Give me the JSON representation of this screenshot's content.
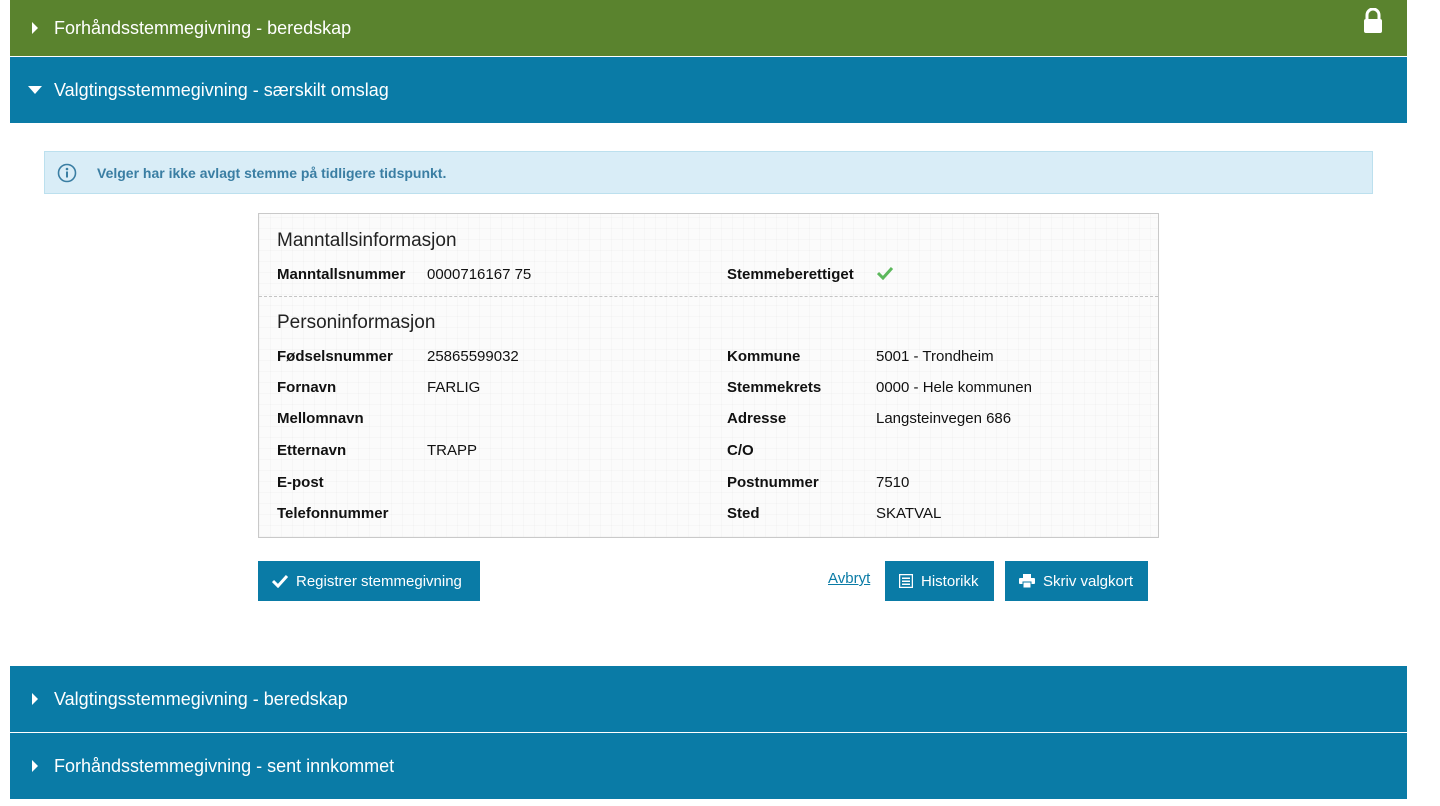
{
  "panels": {
    "p1": {
      "title": "Forhåndsstemmegivning - beredskap",
      "color": "#5a832e"
    },
    "p2": {
      "title": "Valgtingsstemmegivning - særskilt omslag",
      "color": "#0a7ba6"
    },
    "p3": {
      "title": "Valgtingsstemmegivning - beredskap",
      "color": "#0a7ba6"
    },
    "p4": {
      "title": "Forhåndsstemmegivning - sent innkommet",
      "color": "#0a7ba6"
    }
  },
  "info": {
    "message": "Velger har ikke avlagt stemme på tidligere tidspunkt."
  },
  "manntall": {
    "title": "Manntallsinformasjon",
    "number_label": "Manntallsnummer",
    "number_value": "0000716167 75",
    "eligible_label": "Stemmeberettiget",
    "eligible_icon": "check-icon"
  },
  "person": {
    "title": "Personinformasjon",
    "left": [
      {
        "label": "Fødselsnummer",
        "value": "25865599032"
      },
      {
        "label": "Fornavn",
        "value": "FARLIG"
      },
      {
        "label": "Mellomnavn",
        "value": ""
      },
      {
        "label": "Etternavn",
        "value": "TRAPP"
      },
      {
        "label": "E-post",
        "value": ""
      },
      {
        "label": "Telefonnummer",
        "value": ""
      }
    ],
    "right": [
      {
        "label": "Kommune",
        "value": "5001 - Trondheim"
      },
      {
        "label": "Stemmekrets",
        "value": "0000 - Hele kommunen"
      },
      {
        "label": "Adresse",
        "value": "Langsteinvegen 686"
      },
      {
        "label": "C/O",
        "value": ""
      },
      {
        "label": "Postnummer",
        "value": "7510"
      },
      {
        "label": "Sted",
        "value": "SKATVAL"
      }
    ]
  },
  "actions": {
    "register": "Registrer stemmegivning",
    "cancel": "Avbryt",
    "history": "Historikk",
    "print": "Skriv valgkort"
  },
  "colors": {
    "accent": "#0a7ba6",
    "green": "#5a832e",
    "success": "#5cb85c",
    "info_bg": "#d9edf7"
  }
}
